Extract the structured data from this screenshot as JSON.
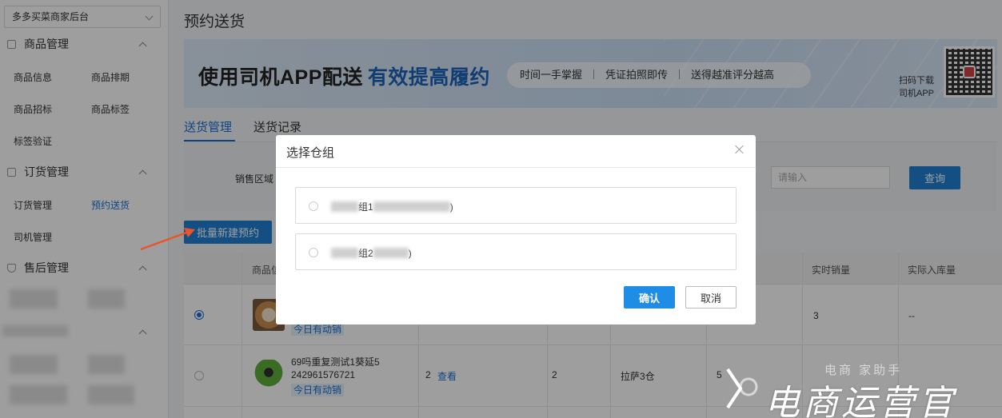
{
  "sidebar": {
    "store_name": "多多买菜商家后台",
    "sections": [
      {
        "title": "商品管理",
        "items": [
          "商品信息",
          "商品排期",
          "商品招标",
          "商品标签",
          "标签验证"
        ]
      },
      {
        "title": "订货管理",
        "items": [
          "订货管理",
          "预约送货",
          "司机管理"
        ]
      },
      {
        "title": "售后管理",
        "items": []
      }
    ],
    "active_item": "预约送货"
  },
  "page": {
    "title": "预约送货",
    "banner": {
      "headline": "使用司机APP配送",
      "headline_highlight": "有效提高履约",
      "features": [
        "时间一手掌握",
        "凭证拍照即传",
        "送得越准评分越高"
      ],
      "scan_line1": "扫码下载",
      "scan_line2": "司机APP"
    },
    "tabs": [
      "送货管理",
      "送货记录"
    ],
    "active_tab": "送货管理",
    "filter": {
      "label": "销售区域",
      "input_placeholder": "请输入",
      "query_button": "查询"
    },
    "batch_button": "批量新建预约"
  },
  "table": {
    "headers": [
      "商品信",
      "实时销量",
      "实际入库量"
    ],
    "rows": [
      {
        "selected": true,
        "tag": "今日有动销",
        "realtime_sales": "3",
        "actual_inbound": "--"
      },
      {
        "selected": false,
        "name": "69吗重复测试1葵延5",
        "code": "242961576721",
        "tag": "今日有动销",
        "qty": "2",
        "view_link": "查看",
        "qty2": "2",
        "warehouse": "拉萨3仓",
        "partial": "5"
      }
    ]
  },
  "modal": {
    "title": "选择仓组",
    "options": [
      {
        "label_visible": "组1",
        "suffix": ")"
      },
      {
        "label_visible": "组2",
        "suffix": ")"
      }
    ],
    "confirm": "确认",
    "cancel": "取消"
  },
  "watermark": {
    "text": "电商运营官",
    "small_text": "电商 家助手"
  },
  "colors": {
    "primary": "#1f80d4",
    "link": "#1b6fd6",
    "arrow": "#e8552a"
  }
}
